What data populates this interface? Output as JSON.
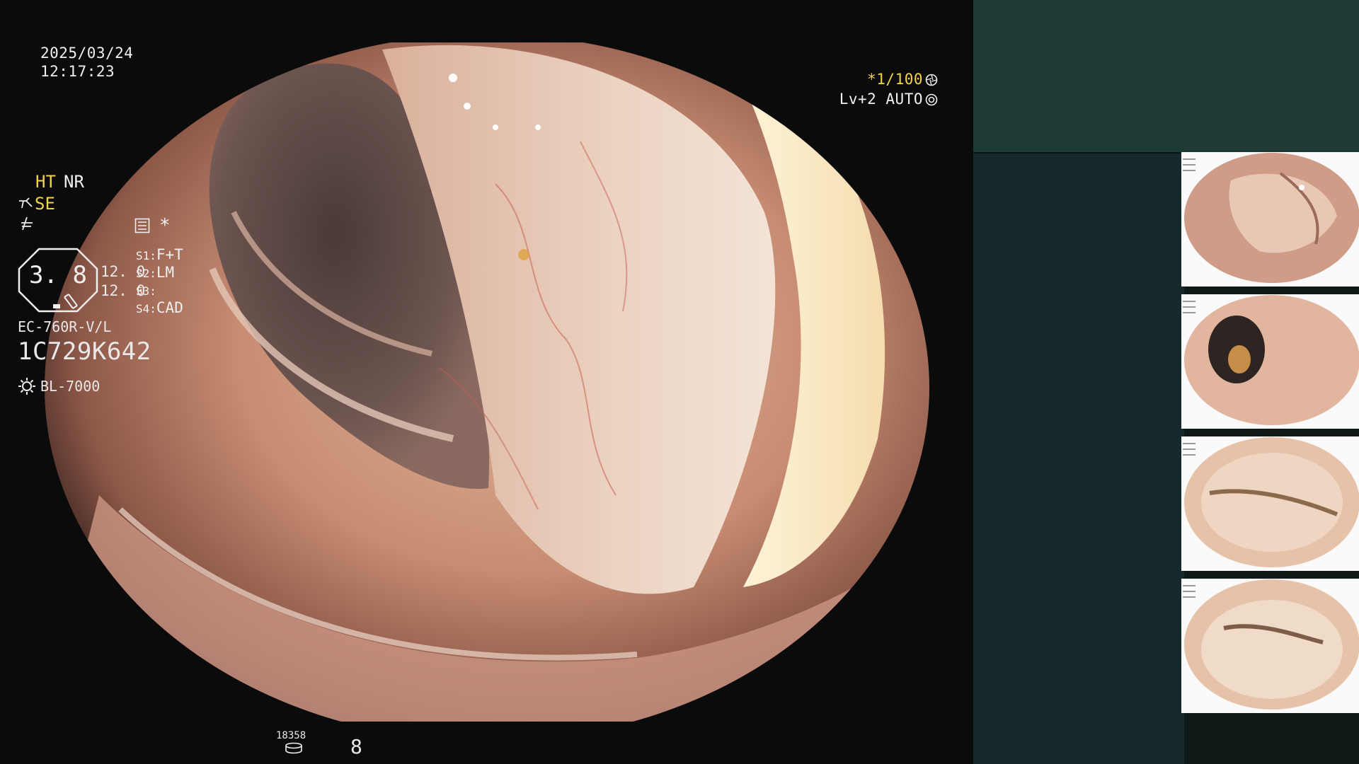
{
  "overlay": {
    "date": "2025/03/24",
    "time": "12:17:23",
    "shutter_prefix": "*",
    "shutter_speed": "1/100",
    "light_level": "Lv+2 AUTO"
  },
  "panel": {
    "ht": "HT",
    "nr": "NR",
    "se": "SE",
    "star": "*",
    "gauge_value": "3. 8",
    "value_1": "12. 0",
    "value_2": "12. 0",
    "s_buttons": [
      {
        "key": "S1:",
        "value": "F+T"
      },
      {
        "key": "S2:",
        "value": "LM"
      },
      {
        "key": "S3:",
        "value": ""
      },
      {
        "key": "S4:",
        "value": "CAD"
      }
    ],
    "scope_model": "EC-760R-V/L",
    "scope_serial": "1C729K642",
    "light_source": "BL-7000",
    "image_counter": "18358",
    "page_number": "8"
  },
  "colors": {
    "accent_yellow": "#f3d34a",
    "panel_top": "#1d3a35",
    "panel_info": "#15292a",
    "overlay_text": "#f0f0f0"
  },
  "icons": {
    "shutter": "aperture-icon",
    "light_mode": "auto-iris-icon",
    "structure_enhancement": "scope-angle-icon",
    "freeze": "freeze-icon",
    "menu": "menu-list-icon",
    "light_source": "lamp-sun-icon",
    "counter": "storage-stack-icon"
  },
  "thumbnails": [
    {
      "name": "thumbnail-1"
    },
    {
      "name": "thumbnail-2"
    },
    {
      "name": "thumbnail-3"
    },
    {
      "name": "thumbnail-4"
    }
  ]
}
